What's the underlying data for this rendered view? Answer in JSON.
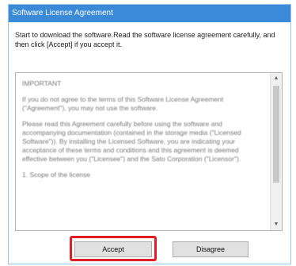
{
  "dialog": {
    "title": "Software License Agreement",
    "intro": "Start to download the software.Read the software license agreement carefully, and then click [Accept] if you accept it.",
    "license_paragraphs": [
      "IMPORTANT",
      "If you do not agree to the terms of this Software License Agreement (\"Agreement\"), you may not use the software.",
      "Please read this Agreement carefully before using the software and accompanying documentation (contained in the storage media (\"Licensed Software\")). By installing the Licensed Software, you are indicating your acceptance of these terms and conditions and this agreement is deemed effective between you (\"Licensee\") and the Sato Corporation (\"Licensor\").",
      "1. Scope of the license"
    ],
    "buttons": {
      "accept": "Accept",
      "disagree": "Disagree"
    },
    "colors": {
      "titlebar": "#3a8ad8",
      "highlight": "#e11e25"
    }
  }
}
